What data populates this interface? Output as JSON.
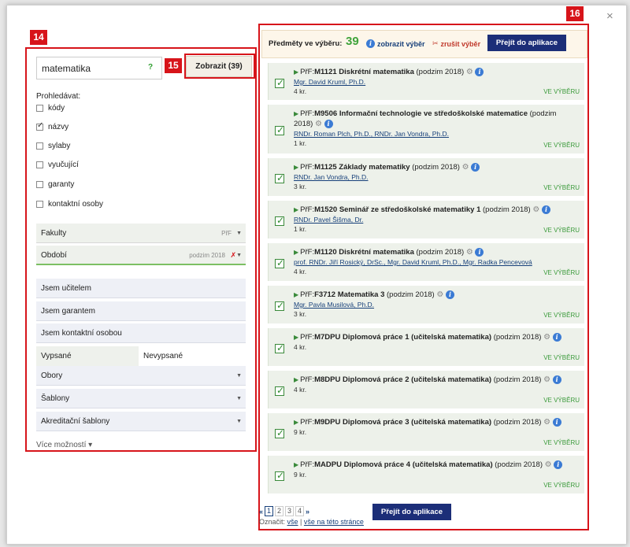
{
  "marks": {
    "left": "14",
    "show": "15",
    "right": "16"
  },
  "close_label": "×",
  "search": {
    "value": "matematika",
    "help": "?",
    "show_button": "Zobrazit (39)"
  },
  "search_in": {
    "label": "Prohledávat:",
    "options": [
      {
        "label": "kódy",
        "checked": false
      },
      {
        "label": "názvy",
        "checked": true
      },
      {
        "label": "sylaby",
        "checked": false
      },
      {
        "label": "vyučující",
        "checked": false
      },
      {
        "label": "garanty",
        "checked": false
      },
      {
        "label": "kontaktní osoby",
        "checked": false
      }
    ]
  },
  "filters": {
    "faculty": {
      "label": "Fakulty",
      "value": "PřF"
    },
    "period": {
      "label": "Období",
      "value": "podzim 2018"
    }
  },
  "options": {
    "teacher": "Jsem učitelem",
    "guarantor": "Jsem garantem",
    "contact": "Jsem kontaktní osobou",
    "listed": "Vypsané",
    "unlisted": "Nevypsané",
    "fields": "Obory",
    "templates": "Šablony",
    "accred": "Akreditační šablony",
    "more": "Více možností ▾"
  },
  "selection": {
    "label": "Předměty ve výběru:",
    "count": "39",
    "show_link": "zobrazit výběr",
    "cancel_link": "zrušit výběr",
    "go_button": "Přejít do aplikace"
  },
  "courses": [
    {
      "fac": "PřF:",
      "code": "M1121",
      "name": "Diskrétní matematika",
      "term": "(podzim 2018)",
      "teachers": "Mgr. David Kruml, Ph.D.",
      "credits": "4 kr.",
      "status": "VE VÝBĚRU"
    },
    {
      "fac": "PřF:",
      "code": "M9506",
      "name": "Informační technologie ve středoškolské matematice",
      "term": "(podzim 2018)",
      "teachers": "RNDr. Roman Plch, Ph.D., RNDr. Jan Vondra, Ph.D.",
      "credits": "1 kr.",
      "status": "VE VÝBĚRU"
    },
    {
      "fac": "PřF:",
      "code": "M1125",
      "name": "Základy matematiky",
      "term": "(podzim 2018)",
      "teachers": "RNDr. Jan Vondra, Ph.D.",
      "credits": "3 kr.",
      "status": "VE VÝBĚRU"
    },
    {
      "fac": "PřF:",
      "code": "M1520",
      "name": "Seminář ze středoškolské matematiky 1",
      "term": "(podzim 2018)",
      "teachers": "RNDr. Pavel Šišma, Dr.",
      "credits": "1 kr.",
      "status": "VE VÝBĚRU"
    },
    {
      "fac": "PřF:",
      "code": "M1120",
      "name": "Diskrétní matematika",
      "term": "(podzim 2018)",
      "teachers": "prof. RNDr. Jiří Rosický, DrSc., Mgr. David Kruml, Ph.D., Mgr. Radka Pencevová",
      "credits": "4 kr.",
      "status": "VE VÝBĚRU"
    },
    {
      "fac": "PřF:",
      "code": "F3712",
      "name": "Matematika 3",
      "term": "(podzim 2018)",
      "teachers": "Mgr. Pavla Musilová, Ph.D.",
      "credits": "3 kr.",
      "status": "VE VÝBĚRU"
    },
    {
      "fac": "PřF:",
      "code": "M7DPU",
      "name": "Diplomová práce 1 (učitelská matematika)",
      "term": "(podzim 2018)",
      "teachers": "",
      "credits": "4 kr.",
      "status": "VE VÝBĚRU"
    },
    {
      "fac": "PřF:",
      "code": "M8DPU",
      "name": "Diplomová práce 2 (učitelská matematika)",
      "term": "(podzim 2018)",
      "teachers": "",
      "credits": "4 kr.",
      "status": "VE VÝBĚRU"
    },
    {
      "fac": "PřF:",
      "code": "M9DPU",
      "name": "Diplomová práce 3 (učitelská matematika)",
      "term": "(podzim 2018)",
      "teachers": "",
      "credits": "9 kr.",
      "status": "VE VÝBĚRU"
    },
    {
      "fac": "PřF:",
      "code": "MADPU",
      "name": "Diplomová práce 4 (učitelská matematika)",
      "term": "(podzim 2018)",
      "teachers": "",
      "credits": "9 kr.",
      "status": "VE VÝBĚRU"
    }
  ],
  "pager": {
    "prev": "«",
    "pages": [
      "1",
      "2",
      "3",
      "4"
    ],
    "next": "»"
  },
  "select_all": {
    "label": "Označit:",
    "all": "vše",
    "page": "vše na této stránce"
  }
}
